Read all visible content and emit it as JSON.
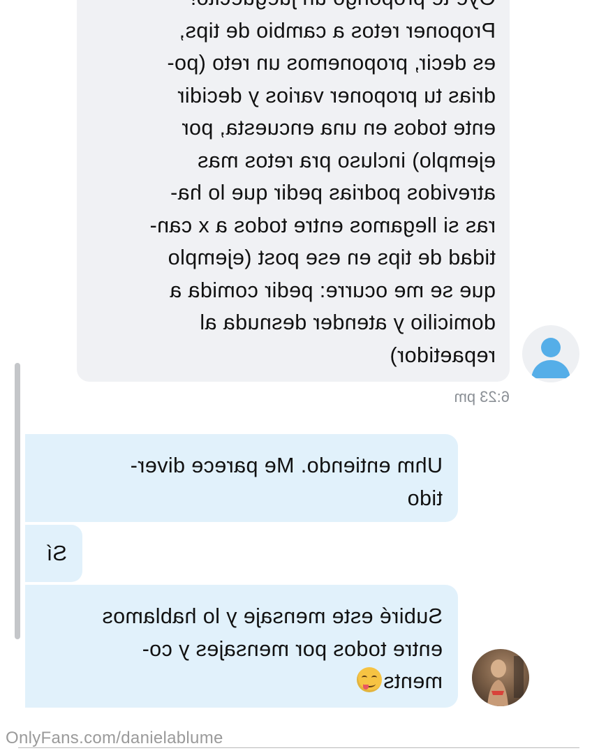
{
  "thread": {
    "incoming_message": {
      "lines": [
        "Oye te propongo un jueguecito!",
        "Proponer retos a cambio de tips,",
        "es decir, proponemos un reto (po-",
        "drias tu proponer varios y decidir",
        "ente todos en una encuesta, por",
        "ejemplo) incluso pra retos mas",
        "atrevidos podrias pedir que lo ha-",
        "ras si llegamos entre todos a x can-",
        "tidad de tips en ese post (ejemplo",
        "que se me ocurre: pedir comida a",
        "domicilio y atender desnuda al",
        "repaetidor)"
      ],
      "timestamp": "6:23 pm"
    },
    "outgoing_messages": [
      {
        "lines": [
          "Uhm entiendo. Me parece diver-",
          "tido"
        ]
      },
      {
        "lines": [
          "Sí"
        ]
      },
      {
        "lines": [
          "Subiré este mensaje y lo hablamos",
          "entre todos por mensajes y co-",
          "ments"
        ],
        "emoji": "face-savoring-food-emoji"
      }
    ]
  },
  "avatars": {
    "incoming": "default-user-icon",
    "outgoing": "profile-photo"
  },
  "watermark": "OnlyFans.com/danielablume",
  "colors": {
    "incoming_bubble": "#f0f1f4",
    "outgoing_bubble": "#e1f1fb",
    "avatar_placeholder": "#55aee8",
    "timestamp": "#8a8f95"
  }
}
